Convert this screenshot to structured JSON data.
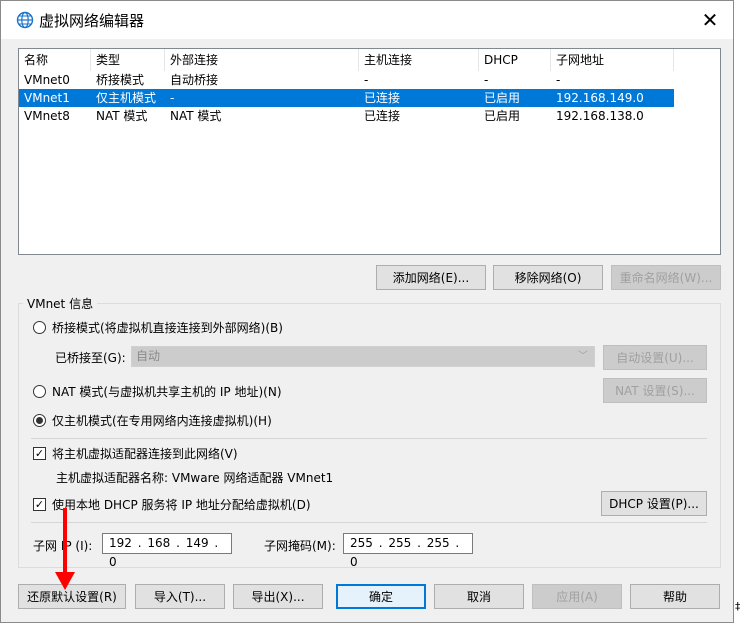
{
  "window": {
    "title": "虚拟网络编辑器",
    "close": "✕"
  },
  "list": {
    "columns": [
      "名称",
      "类型",
      "外部连接",
      "主机连接",
      "DHCP",
      "子网地址"
    ],
    "rows": [
      {
        "name": "VMnet0",
        "type": "桥接模式",
        "external": "自动桥接",
        "host": "-",
        "dhcp": "-",
        "subnet": "-",
        "selected": false
      },
      {
        "name": "VMnet1",
        "type": "仅主机模式",
        "external": "-",
        "host": "已连接",
        "dhcp": "已启用",
        "subnet": "192.168.149.0",
        "selected": true
      },
      {
        "name": "VMnet8",
        "type": "NAT 模式",
        "external": "NAT 模式",
        "host": "已连接",
        "dhcp": "已启用",
        "subnet": "192.168.138.0",
        "selected": false
      }
    ]
  },
  "list_buttons": {
    "add": "添加网络(E)...",
    "remove": "移除网络(O)",
    "rename": "重命名网络(W)..."
  },
  "info": {
    "group_title": "VMnet 信息",
    "bridge_mode": "桥接模式(将虚拟机直接连接到外部网络)(B)",
    "bridged_to_label": "已桥接至(G):",
    "bridged_to_value": "自动",
    "auto_settings": "自动设置(U)...",
    "nat_mode": "NAT 模式(与虚拟机共享主机的 IP 地址)(N)",
    "nat_settings": "NAT 设置(S)...",
    "host_only_mode": "仅主机模式(在专用网络内连接虚拟机)(H)",
    "connect_adapter": "将主机虚拟适配器连接到此网络(V)",
    "adapter_name": "主机虚拟适配器名称: VMware 网络适配器 VMnet1",
    "use_dhcp": "使用本地 DHCP 服务将 IP 地址分配给虚拟机(D)",
    "dhcp_settings": "DHCP 设置(P)...",
    "subnet_ip_label": "子网 IP (I):",
    "subnet_ip_value": "192 . 168 . 149 .  0",
    "subnet_mask_label": "子网掩码(M):",
    "subnet_mask_value": "255 . 255 . 255 .  0"
  },
  "footer": {
    "restore": "还原默认设置(R)",
    "import": "导入(T)...",
    "export": "导出(X)...",
    "ok": "确定",
    "cancel": "取消",
    "apply": "应用(A)",
    "help": "帮助"
  },
  "edge_mark": "‡",
  "colors": {
    "selection": "#0078d7",
    "annotation_arrow": "#ff0000"
  }
}
